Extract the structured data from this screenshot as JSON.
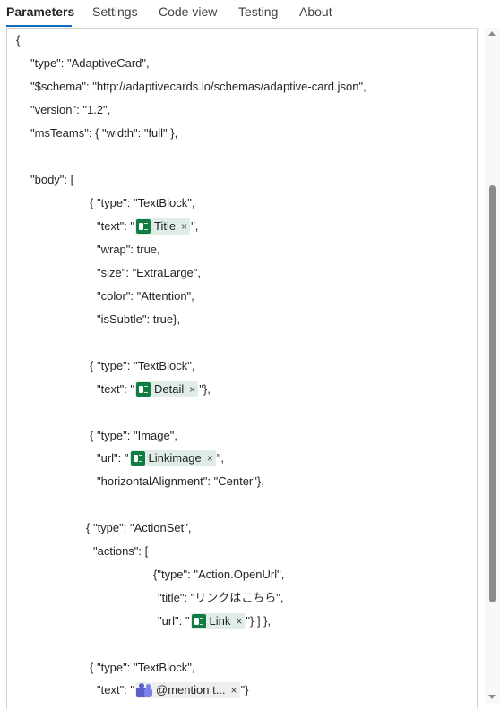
{
  "tabs": [
    {
      "label": "Parameters",
      "active": true
    },
    {
      "label": "Settings"
    },
    {
      "label": "Code view"
    },
    {
      "label": "Testing"
    },
    {
      "label": "About"
    }
  ],
  "code": {
    "l01": "{",
    "l02": "\"type\": \"AdaptiveCard\",",
    "l03": "\"$schema\": \"http://adaptivecards.io/schemas/adaptive-card.json\",",
    "l04": "\"version\": \"1.2\",",
    "l05": "\"msTeams\": { \"width\": \"full\" },",
    "l06": "\"body\": [",
    "l07": "{ \"type\": \"TextBlock\",",
    "l08_pre": "\"text\": \"",
    "l08_post": "\",",
    "l09": "\"wrap\": true,",
    "l10": "\"size\": \"ExtraLarge\",",
    "l11": "\"color\": \"Attention\",",
    "l12": "\"isSubtle\": true},",
    "l13": "{ \"type\": \"TextBlock\",",
    "l14_pre": "\"text\": \"",
    "l14_post": "\"},",
    "l15": "{ \"type\": \"Image\",",
    "l16_pre": "\"url\": \"",
    "l16_post": "\",",
    "l17": "\"horizontalAlignment\": \"Center\"},",
    "l18": "{ \"type\": \"ActionSet\",",
    "l19": "\"actions\": [",
    "l20": "{\"type\": \"Action.OpenUrl\",",
    "l21": "\"title\": \"リンクはこちら\",",
    "l22_pre": "\"url\": \"",
    "l22_post": "\"} ] },",
    "l23": "{ \"type\": \"TextBlock\",",
    "l24_pre": "\"text\": \"",
    "l24_post": "\"}"
  },
  "tokens": {
    "title": {
      "label": "Title",
      "icon": "excel-icon"
    },
    "detail": {
      "label": "Detail",
      "icon": "excel-icon"
    },
    "linkimage": {
      "label": "Linkimage",
      "icon": "excel-icon"
    },
    "link": {
      "label": "Link",
      "icon": "excel-icon"
    },
    "mention": {
      "label": "@mention t...",
      "icon": "teams-icon"
    },
    "close_glyph": "×"
  },
  "colors": {
    "accent": "#0f6cbd",
    "token_bg": "#e0ece6",
    "excel_green": "#107c41",
    "teams_purple": "#5b5fc7"
  }
}
